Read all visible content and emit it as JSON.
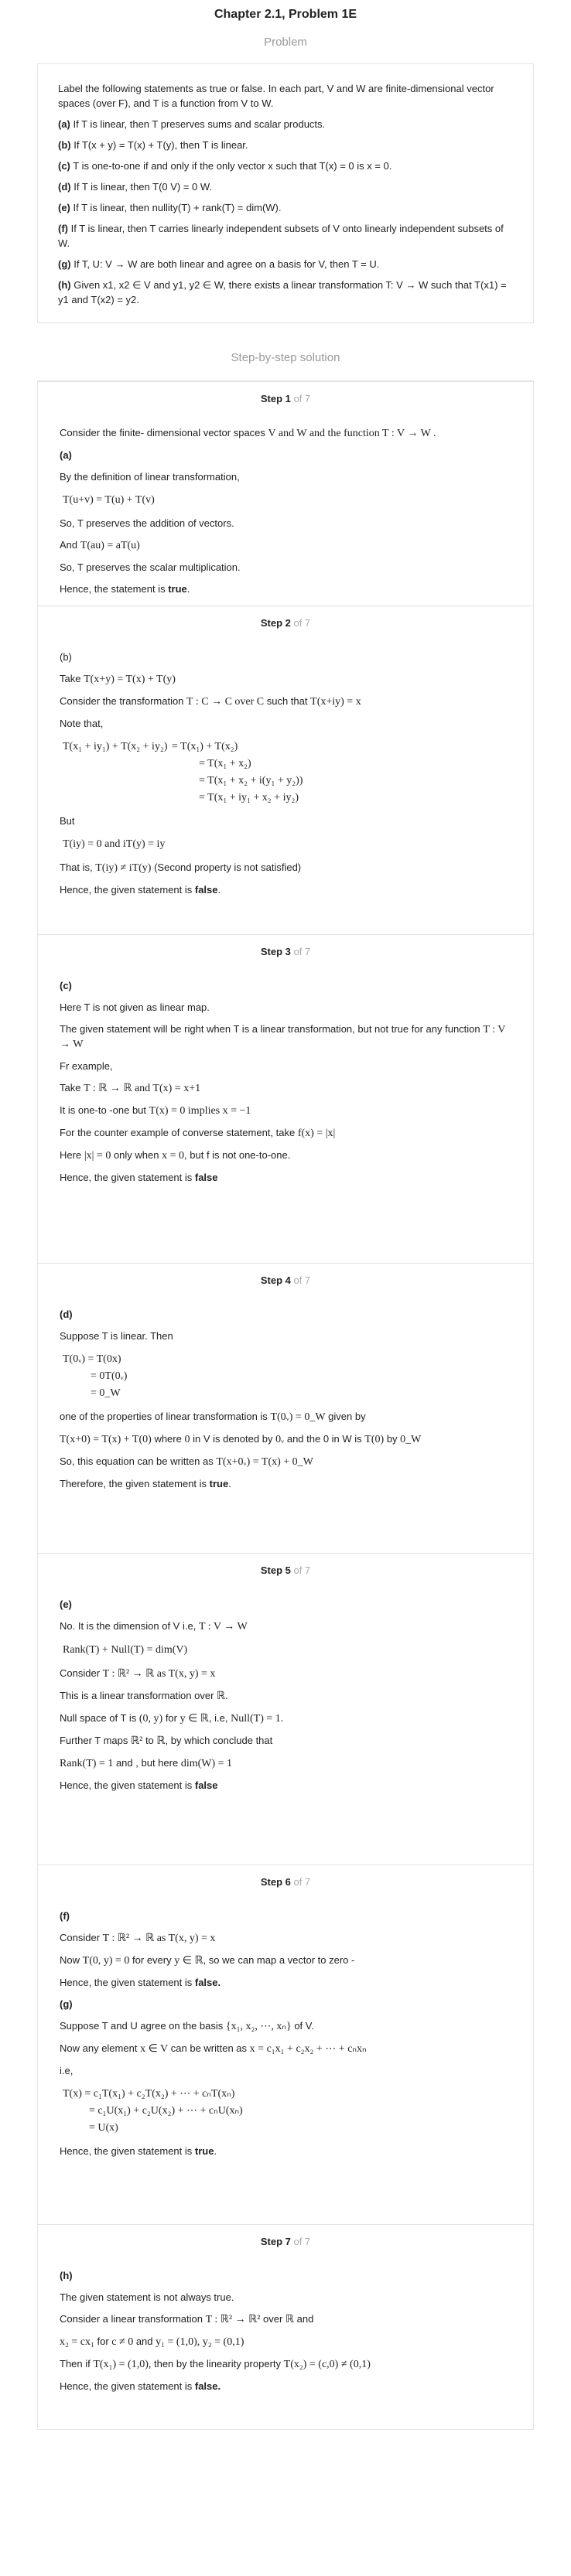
{
  "page_title": "Chapter 2.1, Problem 1E",
  "problem_heading": "Problem",
  "problem": {
    "intro": "Label the following statements as true or false. In each part, V and W are finite-dimensional vector spaces (over F), and T is a function from V to W.",
    "a": "If T is linear, then T preserves sums and scalar products.",
    "b": "If T(x + y) = T(x) + T(y), then T is linear.",
    "c": "T is one-to-one if and only if the only vector x such that T(x) = 0 is x = 0.",
    "d": "If T is linear, then T(0 V) = 0 W.",
    "e": "If T is linear, then nullity(T) + rank(T) = dim(W).",
    "f": "If T is linear, then T carries linearly independent subsets of V onto linearly independent subsets of W.",
    "g": "If T, U: V → W are both linear and agree on a basis for V, then T = U.",
    "h": "Given x1, x2 ∈ V and y1, y2 ∈ W, there exists a linear transformation T: V → W such that T(x1) = y1 and T(x2) = y2.",
    "labels": {
      "a": "(a)",
      "b": "(b)",
      "c": "(c)",
      "d": "(d)",
      "e": "(e)",
      "f": "(f)",
      "g": "(g)",
      "h": "(h)"
    }
  },
  "solution_heading": "Step-by-step solution",
  "steps": [
    {
      "step": "Step 1",
      "of": " of 7"
    },
    {
      "step": "Step 2",
      "of": " of 7"
    },
    {
      "step": "Step 3",
      "of": " of 7"
    },
    {
      "step": "Step 4",
      "of": " of 7"
    },
    {
      "step": "Step 5",
      "of": " of 7"
    },
    {
      "step": "Step 6",
      "of": " of 7"
    },
    {
      "step": "Step 7",
      "of": " of 7"
    }
  ],
  "s1": {
    "l1": "Consider the finite- dimensional vector spaces",
    "l1m": "V and W and the function T : V → W .",
    "lab": "(a)",
    "l2": "By the definition of linear transformation,",
    "m1": "T(u+v) = T(u) + T(v)",
    "l3": "So, T preserves the addition of vectors.",
    "l4": "And",
    "m2": "T(au) = aT(u)",
    "l5": "So, T preserves the scalar multiplication.",
    "l6": "Hence, the statement is ",
    "l6b": "true",
    "dot": "."
  },
  "s2": {
    "lab": "(b)",
    "l1": "Take",
    "m1": "T(x+y) = T(x) + T(y)",
    "l2": "Consider the transformation",
    "m2": "T : C → C over C",
    "l2b": "such that",
    "m3": "T(x+iy) = x",
    "l3": "Note that,",
    "e1l": "T(x₁ + iy₁) + T(x₂ + iy₂)",
    "e1r": "= T(x₁) + T(x₂)",
    "e2": "= T(x₁ + x₂)",
    "e3": "= T(x₁ + x₂ + i(y₁ + y₂))",
    "e4": "= T(x₁ + iy₁ + x₂ + iy₂)",
    "l4": "But",
    "m4": "T(iy) = 0  and   iT(y) = iy",
    "l5": "That is,",
    "m5": "T(iy) ≠ iT(y)",
    "l5b": "(Second property is not satisfied)",
    "l6": "Hence, the given statement is ",
    "l6b": "false",
    "dot": "."
  },
  "s3": {
    "lab": "(c)",
    "l1": "Here T is not given as linear map.",
    "l2": "The given statement will be right when T is a linear transformation, but not true for any function",
    "m1": "T : V → W",
    "l3": "Fr example,",
    "l4": "Take",
    "m2": "T : ℝ → ℝ  and  T(x) = x+1",
    "l5": "It is one-to -one but",
    "m3": "T(x) = 0  implies   x = −1",
    "l6": "For the counter example of converse statement, take",
    "m4": "f(x) = |x|",
    "l7": "Here",
    "m5": "|x| = 0",
    "l7b": "only when",
    "m6": "x = 0",
    "l7c": ", but f is not one-to-one.",
    "l8": "Hence, the given statement is ",
    "l8b": "false"
  },
  "s4": {
    "lab": "(d)",
    "l1": "Suppose T is linear. Then",
    "e1": "T(0ᵥ) = T(0x)",
    "e2": "= 0T(0ᵥ)",
    "e3": "= 0_W",
    "l2": "one of the properties of linear transformation is",
    "m1": "T(0ᵥ) = 0_W",
    "l2b": "given by",
    "m2": "T(x+0) = T(x) + T(0)",
    "l3b": "where",
    "m3": "0",
    "l3c": "in V is denoted by",
    "m4": "0ᵥ",
    "l3d": "and the 0 in W is",
    "m5": "T(0)",
    "l3e": "by",
    "m6": "0_W",
    "l4": "So, this equation can be written as",
    "m7": "T(x+0ᵥ) = T(x) + 0_W",
    "l5": "Therefore, the given statement is ",
    "l5b": "true",
    "dot": "."
  },
  "s5": {
    "lab": "(e)",
    "l1": "No. It is the dimension of V i.e,",
    "m1": "T : V → W",
    "m2": "Rank(T) + Null(T) = dim(V)",
    "l2": "Consider",
    "m3": "T : ℝ² → ℝ  as  T(x, y) = x",
    "l3": "This is a linear transformation over",
    "m4": "ℝ.",
    "l4": "Null space of T is",
    "m5": "(0, y)",
    "l4b": "for",
    "m6": "y ∈ ℝ",
    "l4c": ", i.e,",
    "m7": "Null(T) = 1.",
    "l5": "Further T maps",
    "m8": "ℝ²",
    "l5b": "to",
    "m9": "ℝ",
    "l5c": ", by which conclude that",
    "m10": "Rank(T) = 1",
    "l6b": "and , but here",
    "m11": "dim(W) = 1",
    "l7": "Hence, the given statement is ",
    "l7b": "false"
  },
  "s6": {
    "lab": "(f)",
    "l1": "Consider",
    "m1": "T : ℝ² → ℝ  as  T(x, y) = x",
    "l2": "Now",
    "m2": "T(0, y) = 0",
    "l2b": "for every",
    "m3": "y ∈ ℝ",
    "l2c": ", so we can map a vector to zero -",
    "l3": "Hence, the given statement is ",
    "l3b": "false.",
    "lab2": "(g)",
    "l4": "Suppose T and U agree on the basis",
    "m4": "{x₁, x₂, ⋯, xₙ}",
    "l4b": "of V.",
    "l5": "Now any element",
    "m5": "x ∈ V",
    "l5b": "can be written as",
    "m6": "x = c₁x₁ + c₂x₂ + ⋯ + cₙxₙ",
    "l6": "i.e,",
    "e1": "T(x) = c₁T(x₁) + c₂T(x₂) + ⋯ + cₙT(xₙ)",
    "e2": "= c₁U(x₁) + c₂U(x₂) + ⋯ + cₙU(xₙ)",
    "e3": "= U(x)",
    "l7": "Hence, the given statement is ",
    "l7b": "true",
    "dot": "."
  },
  "s7": {
    "lab": "(h)",
    "l1": "The given statement is not always true.",
    "l2": "Consider a linear transformation",
    "m1": "T : ℝ² → ℝ²",
    "l2b": "over",
    "m2": "ℝ",
    "l2c": "and",
    "m3": "x₂ = cx₁",
    "l3b": "for",
    "m4": "c ≠ 0",
    "l3c": "and",
    "m5": "y₁ = (1,0),  y₂ = (0,1)",
    "l4": "Then if",
    "m6": "T(x₁) = (1,0),",
    "l4b": "then by the linearity property",
    "m7": "T(x₂) = (c,0) ≠ (0,1)",
    "l5": "Hence, the given statement is ",
    "l5b": "false."
  }
}
